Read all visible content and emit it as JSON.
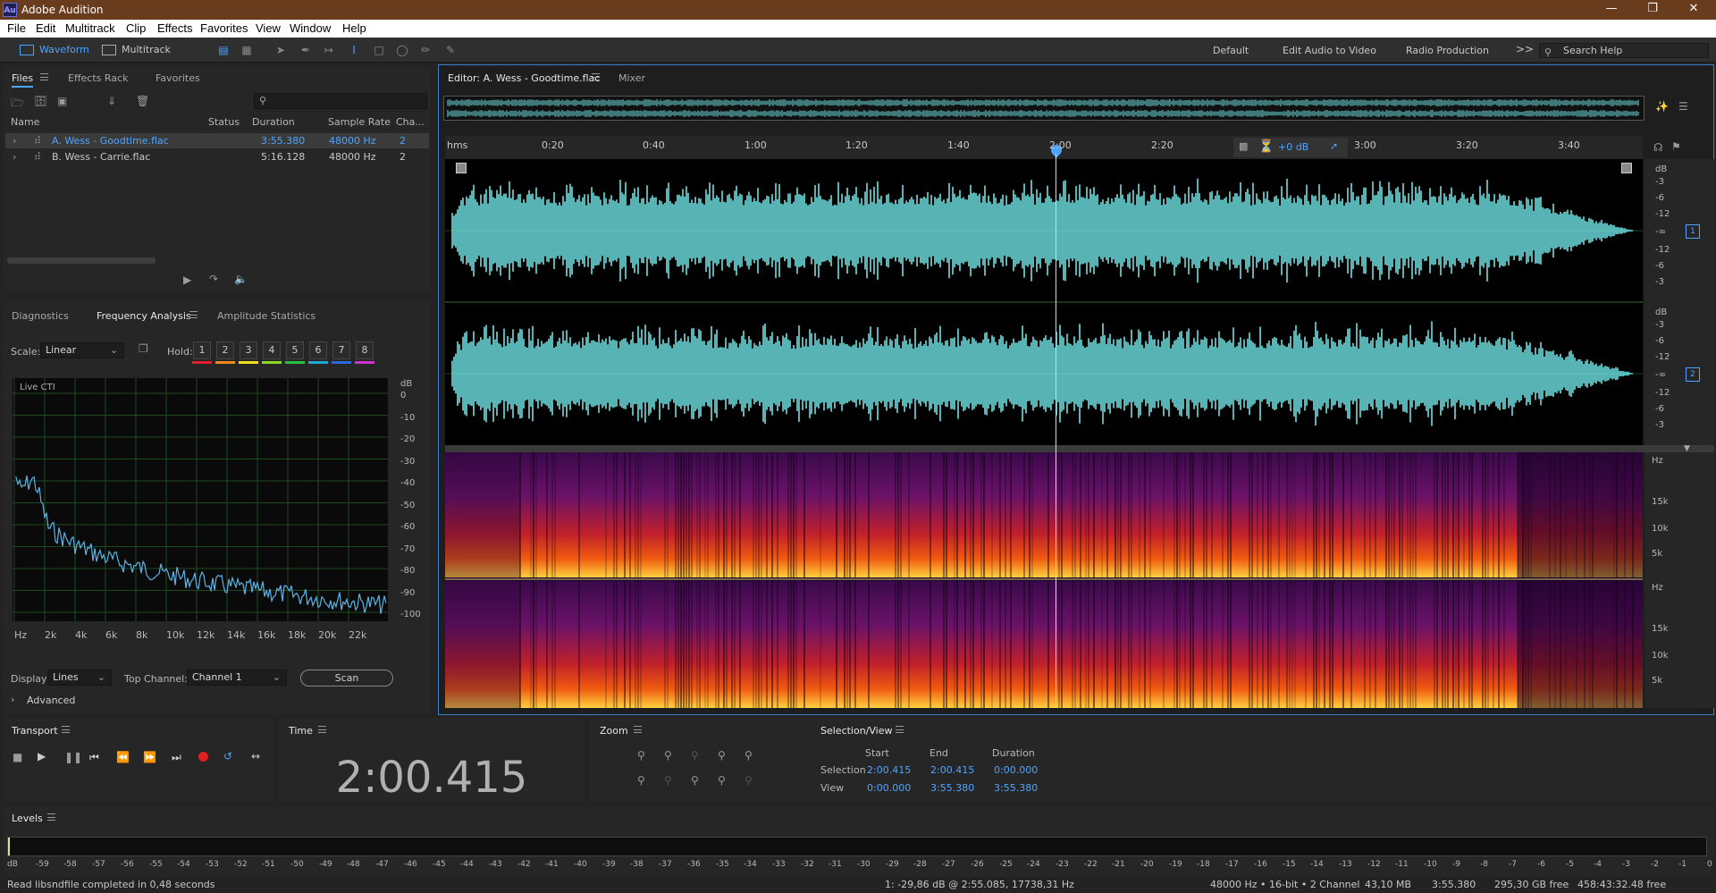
{
  "app": {
    "title": "Adobe Audition",
    "logo": "Au"
  },
  "menu": [
    "File",
    "Edit",
    "Multitrack",
    "Clip",
    "Effects",
    "Favorites",
    "View",
    "Window",
    "Help"
  ],
  "toolbar": {
    "waveform": "Waveform",
    "multitrack": "Multitrack",
    "workspaces": [
      "Default",
      "Edit Audio to Video",
      "Radio Production"
    ],
    "more": ">>",
    "search_placeholder": "Search Help"
  },
  "files_panel": {
    "tabs": [
      "Files",
      "Effects Rack",
      "Favorites"
    ],
    "columns": [
      "Name",
      "Status",
      "Duration",
      "Sample Rate",
      "Cha..."
    ],
    "rows": [
      {
        "name": "A. Wess - Goodtime.flac",
        "status": "",
        "duration": "3:55.380",
        "rate": "48000 Hz",
        "ch": "2",
        "selected": true
      },
      {
        "name": "B. Wess - Carrie.flac",
        "status": "",
        "duration": "5:16.128",
        "rate": "48000 Hz",
        "ch": "2",
        "selected": false
      }
    ]
  },
  "analysis_panel": {
    "tabs": [
      "Diagnostics",
      "Frequency Analysis",
      "Amplitude Statistics"
    ],
    "scale_label": "Scale:",
    "scale_value": "Linear",
    "hold_label": "Hold:",
    "holds": [
      "1",
      "2",
      "3",
      "4",
      "5",
      "6",
      "7",
      "8"
    ],
    "hold_colors": [
      "#e0202a",
      "#f08a1c",
      "#f0e020",
      "#8ad822",
      "#28c040",
      "#20a8d8",
      "#2a68e0",
      "#d030d0"
    ],
    "graph_label": "Live CTI",
    "y_unit": "dB",
    "y_ticks": [
      "0",
      "-10",
      "-20",
      "-30",
      "-40",
      "-50",
      "-60",
      "-70",
      "-80",
      "-90",
      "-100"
    ],
    "x_ticks": [
      "Hz",
      "2k",
      "4k",
      "6k",
      "8k",
      "10k",
      "12k",
      "14k",
      "16k",
      "18k",
      "20k",
      "22k"
    ],
    "display_label": "Display:",
    "display_value": "Lines",
    "top_channel_label": "Top Channel:",
    "top_channel_value": "Channel 1",
    "scan": "Scan",
    "advanced": "Advanced"
  },
  "editor": {
    "tab": "Editor: A. Wess - Goodtime.flac",
    "mixer": "Mixer",
    "timeline": [
      "hms",
      "0:20",
      "0:40",
      "1:00",
      "1:20",
      "1:40",
      "2:00",
      "2:20",
      "3:00",
      "3:20",
      "3:40"
    ],
    "gain": "+0 dB",
    "db_scale": [
      "dB",
      "-3",
      "-6",
      "-12",
      "-∞",
      "-12",
      "-6",
      "-3"
    ],
    "channels": [
      "1",
      "2"
    ],
    "hz_scale": [
      "Hz",
      "15k",
      "10k",
      "5k"
    ]
  },
  "transport": {
    "title": "Transport"
  },
  "time": {
    "title": "Time",
    "value": "2:00.415"
  },
  "zoom": {
    "title": "Zoom"
  },
  "selection": {
    "title": "Selection/View",
    "headers": [
      "Start",
      "End",
      "Duration"
    ],
    "rows": [
      {
        "label": "Selection",
        "start": "2:00.415",
        "end": "2:00.415",
        "duration": "0:00.000"
      },
      {
        "label": "View",
        "start": "0:00.000",
        "end": "3:55.380",
        "duration": "3:55.380"
      }
    ]
  },
  "levels": {
    "title": "Levels",
    "ticks": [
      "dB",
      "-59",
      "-58",
      "-57",
      "-56",
      "-55",
      "-54",
      "-53",
      "-52",
      "-51",
      "-50",
      "-49",
      "-48",
      "-47",
      "-46",
      "-45",
      "-44",
      "-43",
      "-42",
      "-41",
      "-40",
      "-39",
      "-38",
      "-37",
      "-36",
      "-35",
      "-34",
      "-33",
      "-32",
      "-31",
      "-30",
      "-29",
      "-28",
      "-27",
      "-26",
      "-25",
      "-24",
      "-23",
      "-22",
      "-21",
      "-20",
      "-19",
      "-18",
      "-17",
      "-16",
      "-15",
      "-14",
      "-13",
      "-12",
      "-11",
      "-10",
      "-9",
      "-8",
      "-7",
      "-6",
      "-5",
      "-4",
      "-3",
      "-2",
      "-1",
      "0"
    ]
  },
  "status": {
    "message": "Read libsndfile completed in 0,48 seconds",
    "cursor": "1: -29,86 dB @ 2:55.085, 17738,31 Hz",
    "format": "48000 Hz • 16-bit • 2 Channel",
    "size": "43,10 MB",
    "duration": "3:55.380",
    "free": "295,30 GB free",
    "free_time": "458:43:32.48 free"
  },
  "colors": {
    "accent": "#4fa4ff",
    "waveform": "#6ee2e2",
    "playhead": "#e8e85a"
  }
}
